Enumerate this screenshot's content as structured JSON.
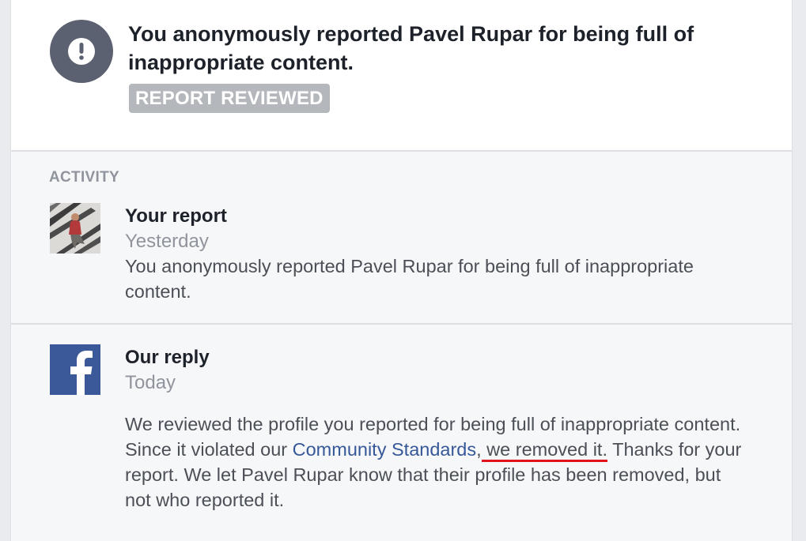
{
  "header": {
    "icon": "alert-exclamation-icon",
    "icon_color": "#5b6170",
    "headline": "You anonymously reported Pavel Rupar for being full of inappropriate content.",
    "status": "REPORT REVIEWED"
  },
  "activity": {
    "heading": "ACTIVITY",
    "entries": [
      {
        "title": "Your report",
        "time": "Yesterday",
        "body": "You anonymously reported Pavel Rupar for being full of inappropriate content.",
        "avatar": "user-photo"
      },
      {
        "title": "Our reply",
        "time": "Today",
        "body_part1": "We reviewed the profile you reported for being full of inappropriate content. Since it violated our ",
        "link_text": "Community Standards",
        "body_part2": ",",
        "highlight_text": " we removed it.",
        "body_part3": " Thanks for your report. We let Pavel Rupar know that their profile has been removed, but not who reported it.",
        "avatar": "facebook-logo-icon",
        "brand_color": "#3b5998",
        "annotation_color": "#e2121a"
      }
    ]
  }
}
